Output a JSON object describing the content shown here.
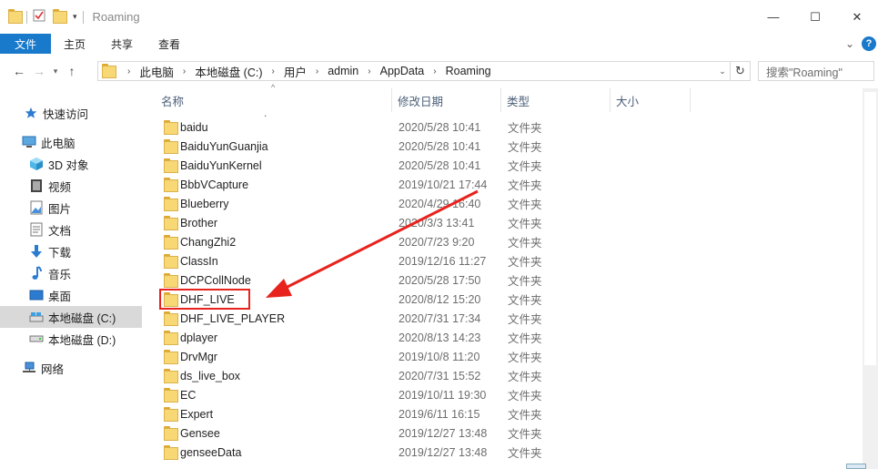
{
  "window": {
    "title": "Roaming",
    "controls": {
      "minimize": "—",
      "maximize": "☐",
      "close": "✕"
    }
  },
  "ribbon": {
    "tabs": [
      "文件",
      "主页",
      "共享",
      "查看"
    ],
    "help": "?"
  },
  "address": {
    "crumbs": [
      "此电脑",
      "本地磁盘 (C:)",
      "用户",
      "admin",
      "AppData",
      "Roaming"
    ],
    "search_placeholder": "搜索\"Roaming\""
  },
  "sidebar": {
    "items": [
      {
        "label": "快速访问",
        "icon": "star-icon"
      },
      {
        "label": "此电脑",
        "icon": "computer-icon"
      },
      {
        "label": "3D 对象",
        "icon": "cube-icon"
      },
      {
        "label": "视频",
        "icon": "video-icon"
      },
      {
        "label": "图片",
        "icon": "picture-icon"
      },
      {
        "label": "文档",
        "icon": "document-icon"
      },
      {
        "label": "下载",
        "icon": "download-icon"
      },
      {
        "label": "音乐",
        "icon": "music-icon"
      },
      {
        "label": "桌面",
        "icon": "desktop-icon"
      },
      {
        "label": "本地磁盘 (C:)",
        "icon": "drive-c-icon"
      },
      {
        "label": "本地磁盘 (D:)",
        "icon": "drive-d-icon"
      },
      {
        "label": "网络",
        "icon": "network-icon"
      }
    ]
  },
  "columns": {
    "name": "名称",
    "modified": "修改日期",
    "type": "类型",
    "size": "大小"
  },
  "files": [
    {
      "name": "baidu",
      "date": "2020/5/28 10:41",
      "type": "文件夹"
    },
    {
      "name": "BaiduYunGuanjia",
      "date": "2020/5/28 10:41",
      "type": "文件夹"
    },
    {
      "name": "BaiduYunKernel",
      "date": "2020/5/28 10:41",
      "type": "文件夹"
    },
    {
      "name": "BbbVCapture",
      "date": "2019/10/21 17:44",
      "type": "文件夹"
    },
    {
      "name": "Blueberry",
      "date": "2020/4/29 16:40",
      "type": "文件夹"
    },
    {
      "name": "Brother",
      "date": "2020/3/3 13:41",
      "type": "文件夹"
    },
    {
      "name": "ChangZhi2",
      "date": "2020/7/23 9:20",
      "type": "文件夹"
    },
    {
      "name": "ClassIn",
      "date": "2019/12/16 11:27",
      "type": "文件夹"
    },
    {
      "name": "DCPCollNode",
      "date": "2020/5/28 17:50",
      "type": "文件夹"
    },
    {
      "name": "DHF_LIVE",
      "date": "2020/8/12 15:20",
      "type": "文件夹"
    },
    {
      "name": "DHF_LIVE_PLAYER",
      "date": "2020/7/31 17:34",
      "type": "文件夹"
    },
    {
      "name": "dplayer",
      "date": "2020/8/13 14:23",
      "type": "文件夹"
    },
    {
      "name": "DrvMgr",
      "date": "2019/10/8 11:20",
      "type": "文件夹"
    },
    {
      "name": "ds_live_box",
      "date": "2020/7/31 15:52",
      "type": "文件夹"
    },
    {
      "name": "EC",
      "date": "2019/10/11 19:30",
      "type": "文件夹"
    },
    {
      "name": "Expert",
      "date": "2019/6/11 16:15",
      "type": "文件夹"
    },
    {
      "name": "Gensee",
      "date": "2019/12/27 13:48",
      "type": "文件夹"
    },
    {
      "name": "genseeData",
      "date": "2019/12/27 13:48",
      "type": "文件夹"
    }
  ],
  "annotation": {
    "highlighted_item": "DHF_LIVE",
    "color": "#e8221c"
  },
  "colors": {
    "accent": "#1979ca",
    "folder": "#f8d775",
    "selected": "#d9d9d9"
  }
}
